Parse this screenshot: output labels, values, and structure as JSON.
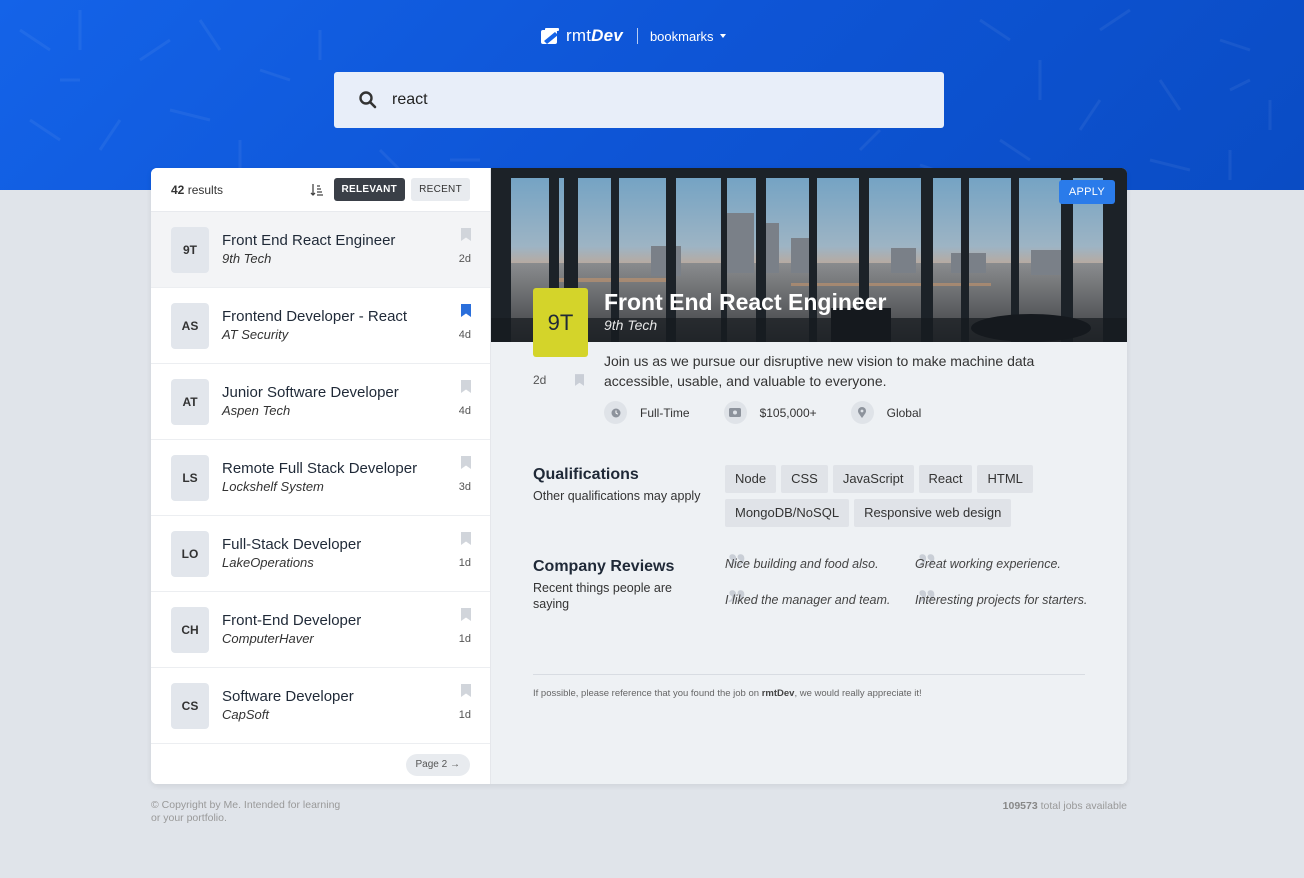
{
  "brand": {
    "name_prefix": "rmt",
    "name_suffix": "Dev",
    "bookmarks_label": "bookmarks"
  },
  "search": {
    "value": "react"
  },
  "sidebar": {
    "results_count": "42",
    "results_label": "results",
    "sort_relevant": "RELEVANT",
    "sort_recent": "RECENT",
    "pagination": "Page 2 →",
    "jobs": [
      {
        "badge": "9T",
        "title": "Front End React Engineer",
        "company": "9th Tech",
        "age": "2d",
        "bookmarked": false
      },
      {
        "badge": "AS",
        "title": "Frontend Developer - React",
        "company": "AT Security",
        "age": "4d",
        "bookmarked": true
      },
      {
        "badge": "AT",
        "title": "Junior Software Developer",
        "company": "Aspen Tech",
        "age": "4d",
        "bookmarked": false
      },
      {
        "badge": "LS",
        "title": "Remote Full Stack Developer",
        "company": "Lockshelf System",
        "age": "3d",
        "bookmarked": false
      },
      {
        "badge": "LO",
        "title": "Full-Stack Developer",
        "company": "LakeOperations",
        "age": "1d",
        "bookmarked": false
      },
      {
        "badge": "CH",
        "title": "Front-End Developer",
        "company": "ComputerHaver",
        "age": "1d",
        "bookmarked": false
      },
      {
        "badge": "CS",
        "title": "Software Developer",
        "company": "CapSoft",
        "age": "1d",
        "bookmarked": false
      }
    ]
  },
  "detail": {
    "apply_label": "APPLY",
    "badge": "9T",
    "title": "Front End React Engineer",
    "company": "9th Tech",
    "age": "2d",
    "description": "Join us as we pursue our disruptive new vision to make machine data accessible, usable, and valuable to everyone.",
    "duration": "Full-Time",
    "salary": "$105,000+",
    "location": "Global",
    "qualifications_title": "Qualifications",
    "qualifications_sub": "Other qualifications may apply",
    "qualifications": [
      "Node",
      "CSS",
      "JavaScript",
      "React",
      "HTML",
      "MongoDB/NoSQL",
      "Responsive web design"
    ],
    "reviews_title": "Company Reviews",
    "reviews_sub": "Recent things people are saying",
    "reviews": [
      "Nice building and food also.",
      "Great working experience.",
      "I liked the manager and team.",
      "Interesting projects for starters."
    ],
    "footnote_before": "If possible, please reference that you found the job on ",
    "footnote_brand": "rmtDev",
    "footnote_after": ", we would really appreciate it!"
  },
  "footer": {
    "copyright": "© Copyright by Me. Intended for learning or your portfolio.",
    "total_jobs": "109573",
    "total_label": " total jobs available"
  },
  "colors": {
    "header": "#1463e8",
    "accent": "#2a7bea",
    "badge_detail": "#d4d42a",
    "bookmark_active": "#2b6fdb"
  }
}
